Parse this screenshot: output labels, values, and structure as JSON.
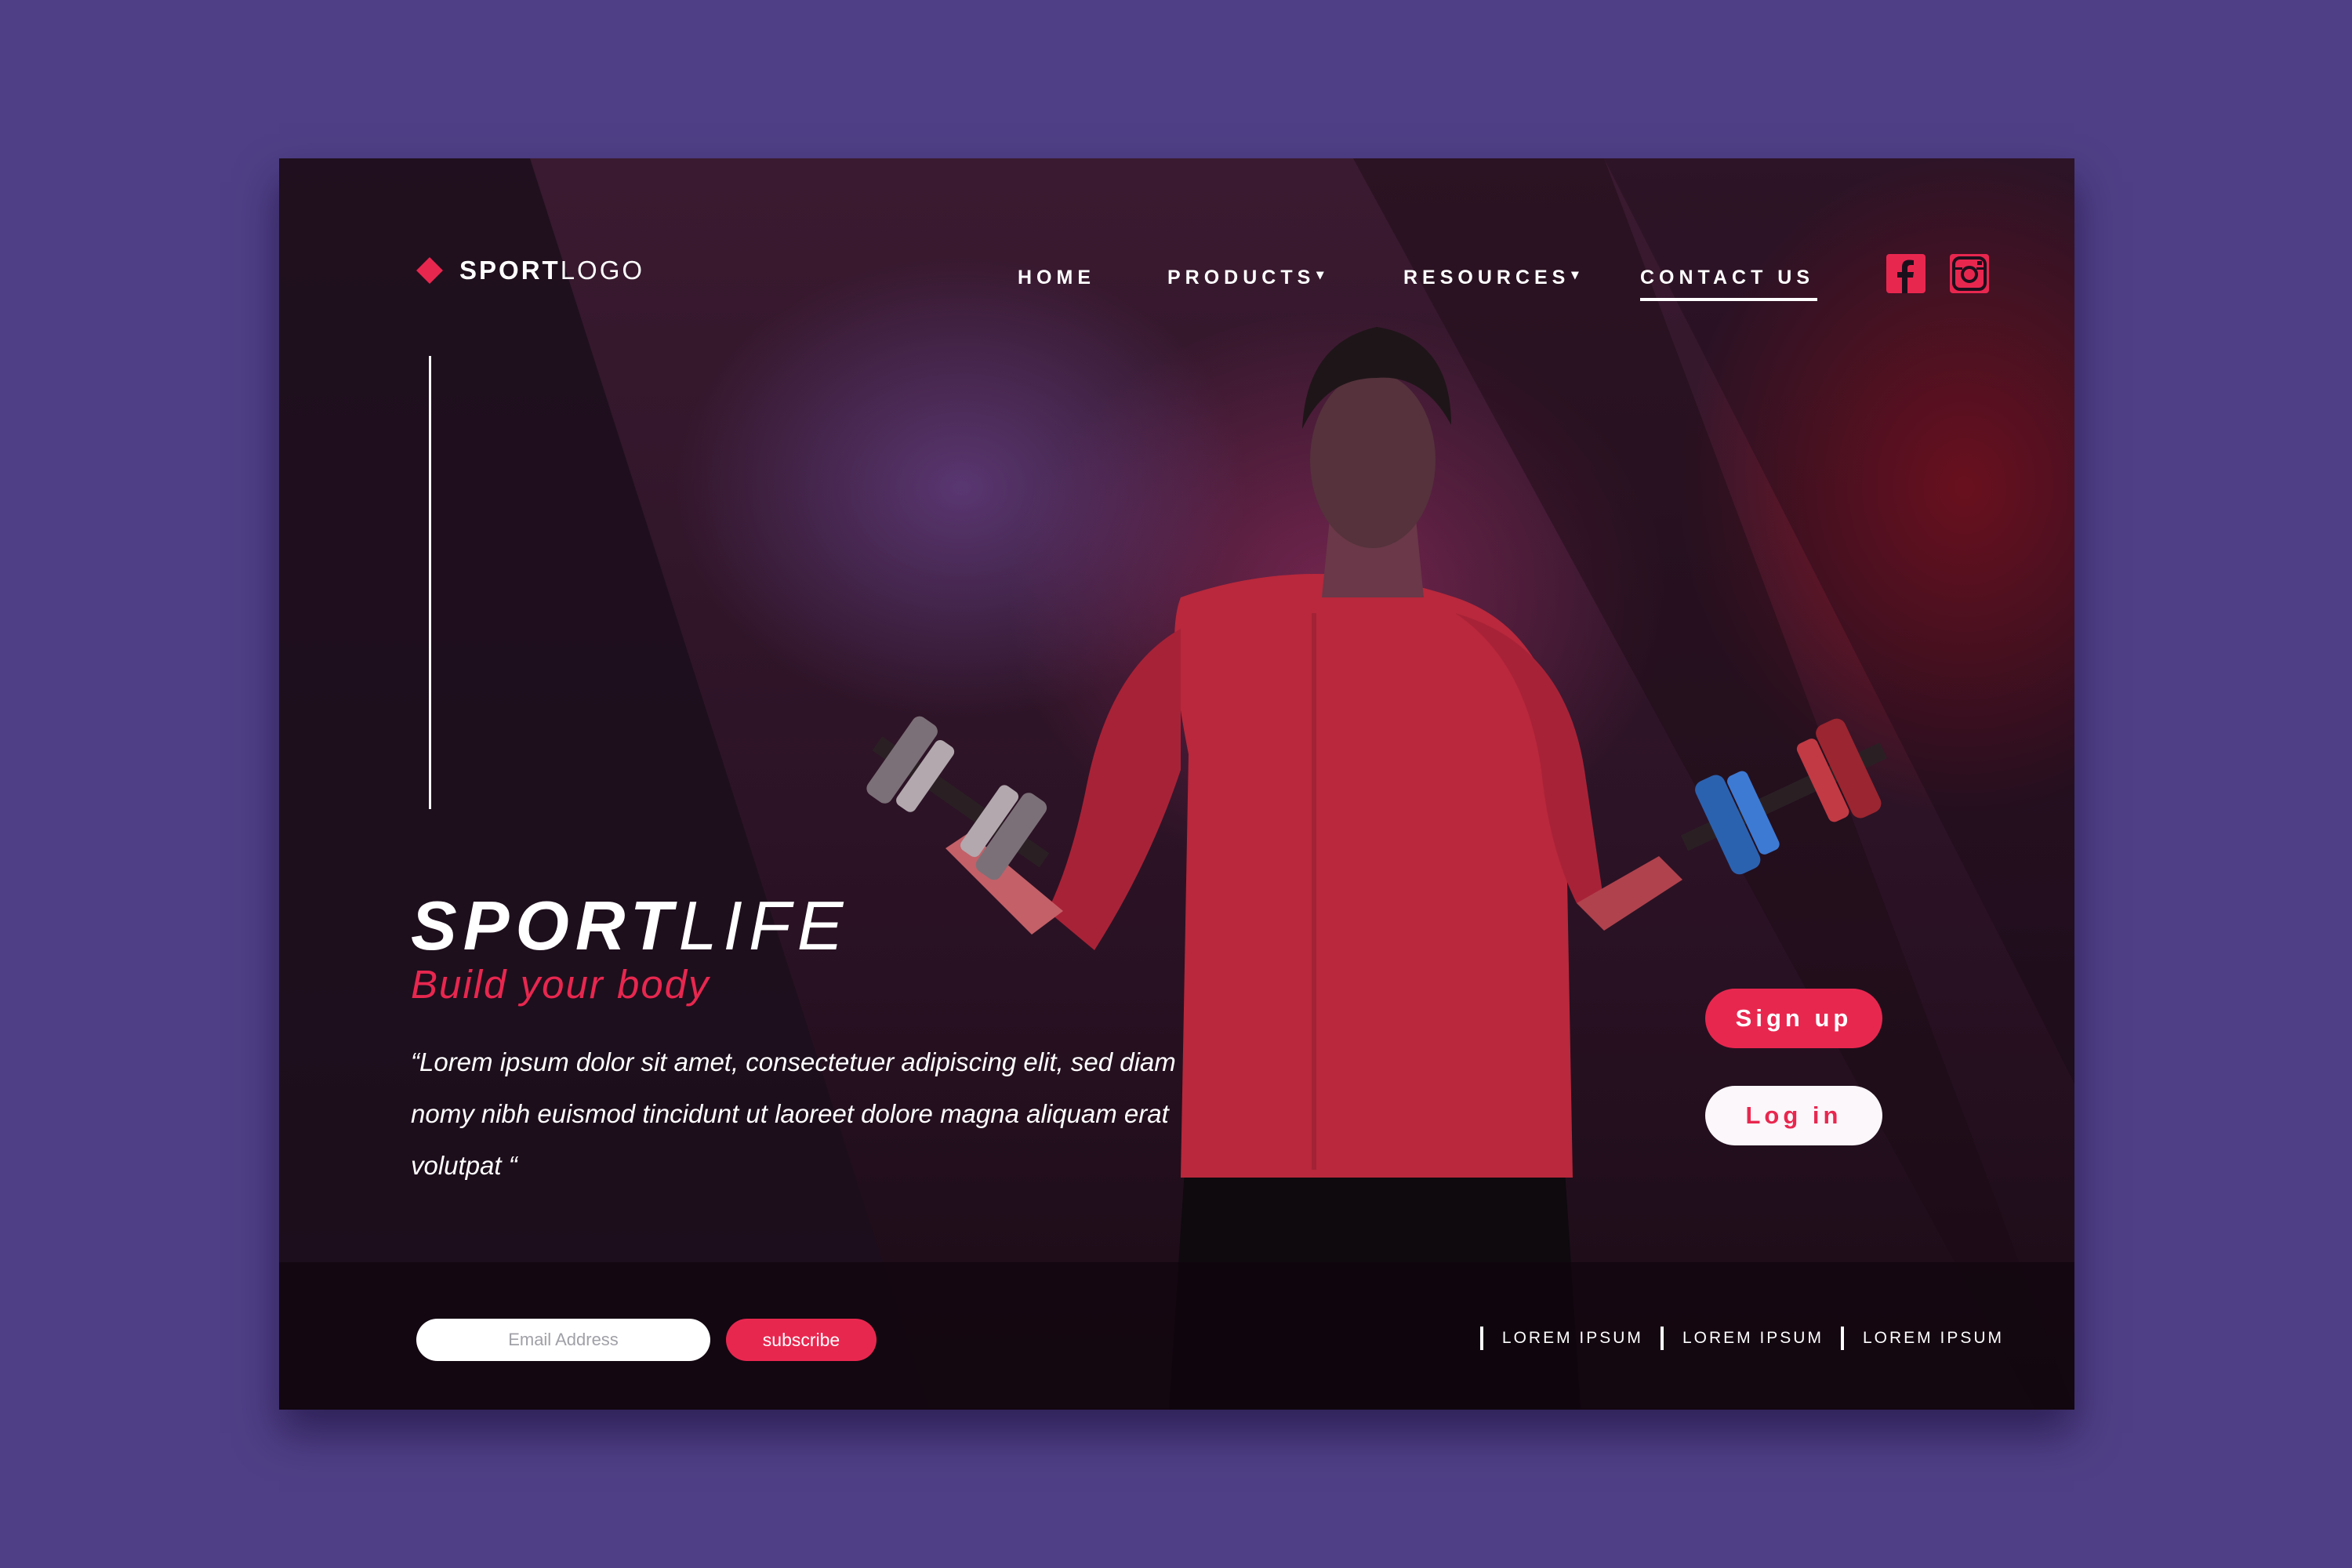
{
  "brand": {
    "logo_bold": "SPORT",
    "logo_light": "LOGO"
  },
  "nav": {
    "home": "HOME",
    "products": "PRODUCTS",
    "resources": "RESOURCES",
    "contact": "CONTACT US",
    "caret": "▾"
  },
  "social": {
    "facebook_icon": "facebook-icon",
    "instagram_icon": "instagram-icon"
  },
  "hero": {
    "title_bold": "SPORT",
    "title_light": "LIFE",
    "subtitle": "Build your body",
    "quote": "“Lorem ipsum dolor sit amet, consectetuer adipiscing elit, sed diam nomy nibh euismod tincidunt ut laoreet dolore magna aliquam erat volutpat “"
  },
  "buttons": {
    "signup": "Sign up",
    "login": "Log in"
  },
  "footer": {
    "email_placeholder": "Email Address",
    "subscribe": "subscribe",
    "links": [
      "LOREM IPSUM",
      "LOREM IPSUM",
      "LOREM IPSUM"
    ]
  },
  "colors": {
    "accent": "#e8274f",
    "background": "#4f3f86",
    "card": "#1c0f1c"
  }
}
